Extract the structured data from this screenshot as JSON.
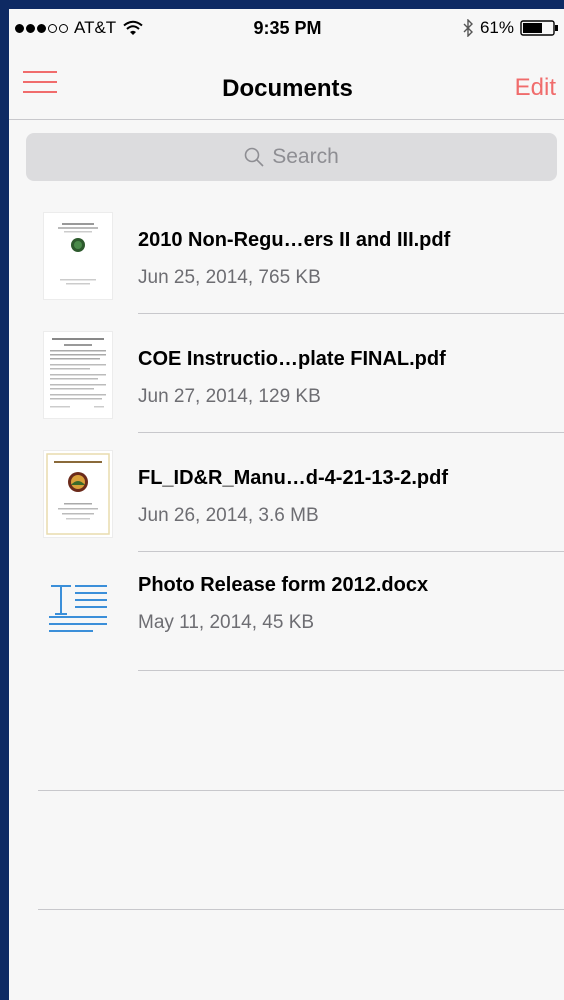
{
  "status": {
    "carrier": "AT&T",
    "time": "9:35 PM",
    "battery": "61%",
    "signal_bars_filled": 3,
    "signal_bars_total": 5
  },
  "nav": {
    "title": "Documents",
    "edit_label": "Edit",
    "menu_icon": "hamburger-menu-icon"
  },
  "search": {
    "placeholder": "Search",
    "icon": "search-icon"
  },
  "documents": [
    {
      "title": "2010 Non-Regu…ers II and III.pdf",
      "meta": "Jun 25, 2014, 765 KB",
      "icon": "pdf-thumbnail"
    },
    {
      "title": "COE Instructio…plate FINAL.pdf",
      "meta": "Jun 27, 2014, 129 KB",
      "icon": "pdf-thumbnail"
    },
    {
      "title": "FL_ID&R_Manu…d-4-21-13-2.pdf",
      "meta": "Jun 26, 2014, 3.6 MB",
      "icon": "pdf-thumbnail"
    },
    {
      "title": "Photo Release form 2012.docx",
      "meta": "May 11, 2014, 45 KB",
      "icon": "docx-icon"
    }
  ],
  "colors": {
    "accent": "#f06c6c",
    "frame": "#0e2a63",
    "background": "#f7f7f7",
    "search_bg": "#dcdcde",
    "docx_blue": "#3b8fd9"
  }
}
